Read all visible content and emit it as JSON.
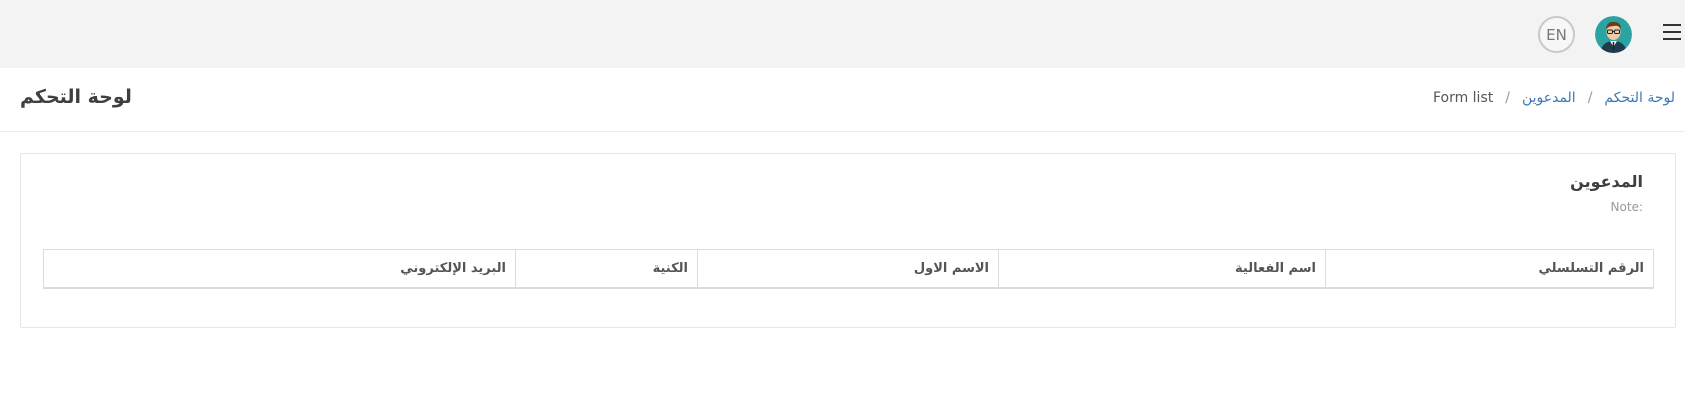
{
  "topbar": {
    "language_button": "EN",
    "menu_icon": "hamburger-icon",
    "avatar_icon": "user-avatar-icon"
  },
  "header": {
    "page_title": "لوحة التحكم",
    "breadcrumb": {
      "home": "لوحة التحكم",
      "section": "المدعوين",
      "separator": "/",
      "current": "Form list"
    }
  },
  "card": {
    "title": "المدعوين",
    "note": "Note:"
  },
  "table": {
    "columns": [
      "الرقم التسلسلي",
      "اسم الفعالية",
      "الاسم الاول",
      "الكنية",
      "البريد الإلكتروني"
    ]
  },
  "colors": {
    "topbar_bg": "#f3f3f3",
    "link": "#3c78b5",
    "avatar_bg": "#2ba3a0"
  }
}
